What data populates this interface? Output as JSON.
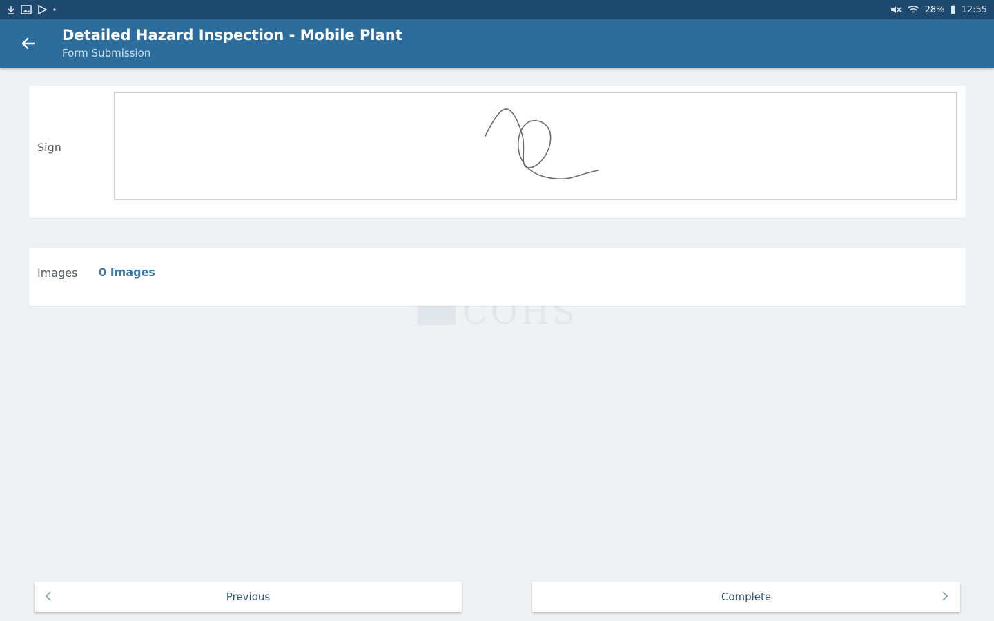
{
  "status_bar": {
    "left_icons": [
      "download-icon",
      "image-icon",
      "play-store-icon",
      "dot-icon"
    ],
    "right_icons": [
      "mute-icon",
      "wifi-icon"
    ],
    "battery": "28%",
    "time": "12:55"
  },
  "app_bar": {
    "title": "Detailed Hazard Inspection - Mobile Plant",
    "subtitle": "Form Submission",
    "back_icon": "arrow-left-icon"
  },
  "form": {
    "sign": {
      "label": "Sign"
    },
    "images": {
      "label": "Images",
      "link": "0 Images"
    }
  },
  "nav": {
    "previous_label": "Previous",
    "complete_label": "Complete"
  },
  "colors": {
    "status_bar": "#1f4a6f",
    "app_bar": "#2c6d9c",
    "background": "#eff2f5",
    "link": "#3d78a8"
  }
}
